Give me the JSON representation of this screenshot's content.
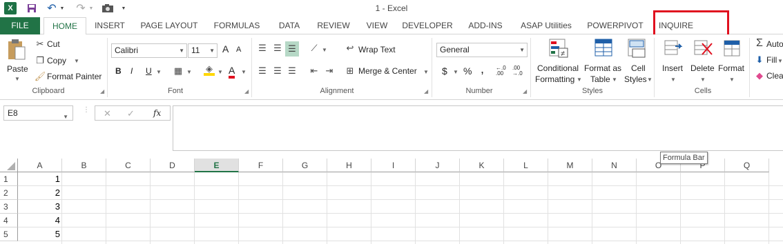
{
  "window": {
    "title": "1 - Excel"
  },
  "qat": {
    "undo": "↶",
    "redo": "↷"
  },
  "tabs": [
    {
      "label": "FILE",
      "id": "file"
    },
    {
      "label": "HOME",
      "id": "home"
    },
    {
      "label": "INSERT",
      "id": "insert"
    },
    {
      "label": "PAGE LAYOUT",
      "id": "page-layout"
    },
    {
      "label": "FORMULAS",
      "id": "formulas"
    },
    {
      "label": "DATA",
      "id": "data"
    },
    {
      "label": "REVIEW",
      "id": "review"
    },
    {
      "label": "VIEW",
      "id": "view"
    },
    {
      "label": "DEVELOPER",
      "id": "developer"
    },
    {
      "label": "ADD-INS",
      "id": "add-ins"
    },
    {
      "label": "ASAP Utilities",
      "id": "asap-utilities"
    },
    {
      "label": "POWERPIVOT",
      "id": "powerpivot"
    },
    {
      "label": "INQUIRE",
      "id": "inquire"
    }
  ],
  "ribbon": {
    "clipboard": {
      "label": "Clipboard",
      "paste": "Paste",
      "cut": "Cut",
      "copy": "Copy",
      "format_painter": "Format Painter"
    },
    "font": {
      "label": "Font",
      "name": "Calibri",
      "size": "11",
      "bold": "B",
      "italic": "I",
      "underline": "U",
      "font_color_letter": "A",
      "grow": "A",
      "shrink": "A"
    },
    "alignment": {
      "label": "Alignment",
      "wrap_text": "Wrap Text",
      "merge_center": "Merge & Center"
    },
    "number": {
      "label": "Number",
      "format": "General",
      "currency": "$",
      "percent": "%",
      "comma": ",",
      "inc_decimal": "←.0 .00",
      "dec_decimal": ".00 →.0"
    },
    "styles": {
      "label": "Styles",
      "conditional_formatting": [
        "Conditional",
        "Formatting"
      ],
      "format_as_table": [
        "Format as",
        "Table"
      ],
      "cell_styles": [
        "Cell",
        "Styles"
      ]
    },
    "cells": {
      "label": "Cells",
      "insert": "Insert",
      "delete": "Delete",
      "format": "Format"
    },
    "editing": {
      "autosum": "Auto",
      "fill": "Fill",
      "clear": "Clea"
    }
  },
  "formula_bar": {
    "name_box": "E8",
    "cancel": "✕",
    "enter": "✓",
    "fx": "fx",
    "value": "",
    "tooltip": "Formula Bar"
  },
  "grid": {
    "columns": [
      "A",
      "B",
      "C",
      "D",
      "E",
      "F",
      "G",
      "H",
      "I",
      "J",
      "K",
      "L",
      "M",
      "N",
      "O",
      "P",
      "Q"
    ],
    "selected_column": "E",
    "rows": [
      "1",
      "2",
      "3",
      "4",
      "5"
    ],
    "column_a_values": [
      "1",
      "2",
      "3",
      "4",
      "5"
    ]
  },
  "colors": {
    "excel_green": "#217346",
    "highlight_red": "#e0101f"
  }
}
